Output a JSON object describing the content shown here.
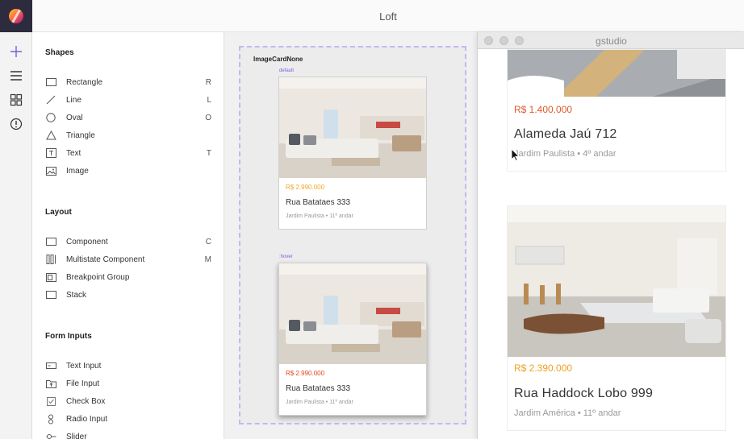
{
  "window": {
    "title": "Loft"
  },
  "toolbar": {
    "icons": [
      "add-icon",
      "menu-icon",
      "components-icon",
      "info-icon"
    ]
  },
  "panel": {
    "sections": [
      {
        "title": "Shapes",
        "items": [
          {
            "label": "Rectangle",
            "shortcut": "R",
            "icon": "rectangle-icon"
          },
          {
            "label": "Line",
            "shortcut": "L",
            "icon": "line-icon"
          },
          {
            "label": "Oval",
            "shortcut": "O",
            "icon": "oval-icon"
          },
          {
            "label": "Triangle",
            "shortcut": "",
            "icon": "triangle-icon"
          },
          {
            "label": "Text",
            "shortcut": "T",
            "icon": "text-icon"
          },
          {
            "label": "Image",
            "shortcut": "",
            "icon": "image-icon"
          }
        ]
      },
      {
        "title": "Layout",
        "items": [
          {
            "label": "Component",
            "shortcut": "C",
            "icon": "component-icon"
          },
          {
            "label": "Multistate Component",
            "shortcut": "M",
            "icon": "multistate-icon"
          },
          {
            "label": "Breakpoint Group",
            "shortcut": "",
            "icon": "breakpoint-icon"
          },
          {
            "label": "Stack",
            "shortcut": "",
            "icon": "stack-icon"
          }
        ]
      },
      {
        "title": "Form Inputs",
        "items": [
          {
            "label": "Text Input",
            "shortcut": "",
            "icon": "text-input-icon"
          },
          {
            "label": "File Input",
            "shortcut": "",
            "icon": "file-input-icon"
          },
          {
            "label": "Check Box",
            "shortcut": "",
            "icon": "checkbox-icon"
          },
          {
            "label": "Radio Input",
            "shortcut": "",
            "icon": "radio-icon"
          },
          {
            "label": "Slider",
            "shortcut": "",
            "icon": "slider-icon"
          }
        ]
      }
    ]
  },
  "canvas": {
    "frame_title": "ImageCardNone",
    "states": [
      {
        "label": "default",
        "price": "R$ 2.990.000",
        "street": "Rua Batataes 333",
        "sub": "Jardim Paulista • 11º andar"
      },
      {
        "label": ":hover",
        "price": "R$ 2.990.000",
        "street": "Rua Batataes 333",
        "sub": "Jardim Paulista • 11º andar"
      }
    ]
  },
  "preview": {
    "title": "gstudio",
    "cards": [
      {
        "price": "R$ 1.400.000",
        "street": "Alameda Jaú 712",
        "sub": "Jardim Paulista • 4º andar"
      },
      {
        "price": "R$ 2.390.000",
        "street": "Rua Haddock Lobo 999",
        "sub": "Jardim América • 11º andar"
      }
    ]
  },
  "colors": {
    "accent": "#7c5ce0",
    "price_default": "#f5a623",
    "price_hover": "#e8451e",
    "price_preview_1": "#e05a2a",
    "price_preview_2": "#f0a020",
    "frame_border": "#c9b6f0"
  }
}
